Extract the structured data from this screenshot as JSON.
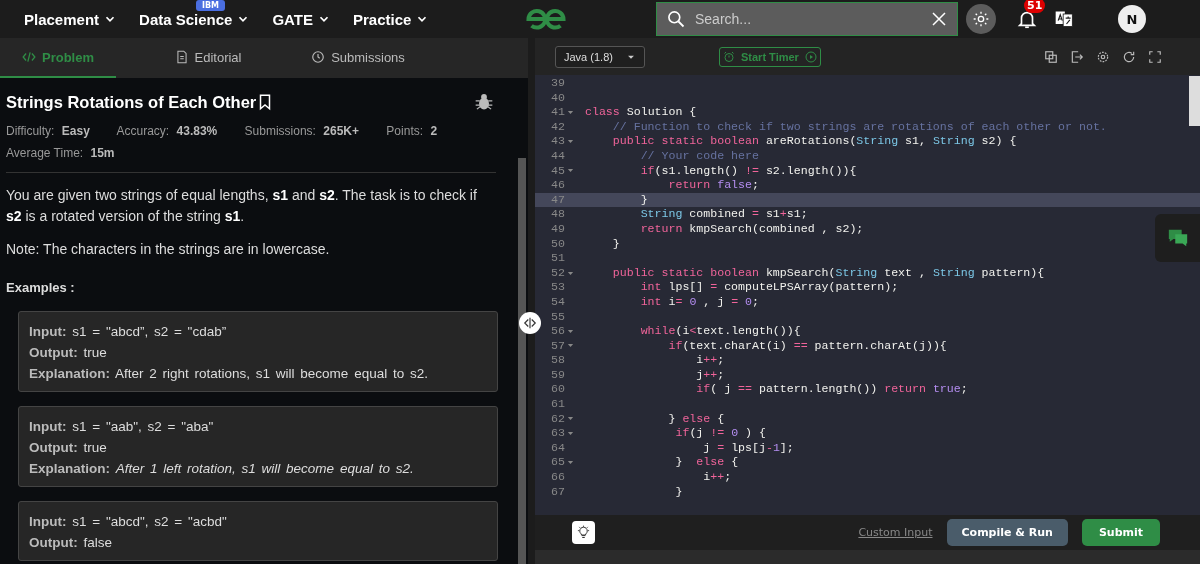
{
  "header": {
    "nav": [
      {
        "label": "Placement"
      },
      {
        "label": "Data Science",
        "badge": "IBM"
      },
      {
        "label": "GATE"
      },
      {
        "label": "Practice"
      }
    ],
    "search": {
      "placeholder": "Search..."
    },
    "notifications": "51",
    "avatar": "N"
  },
  "tabs": [
    {
      "label": "Problem",
      "selected": true
    },
    {
      "label": "Editorial",
      "selected": false
    },
    {
      "label": "Submissions",
      "selected": false
    }
  ],
  "problem": {
    "title": "Strings Rotations of Each Other",
    "meta": [
      {
        "label": "Difficulty:",
        "value": "Easy"
      },
      {
        "label": "Accuracy:",
        "value": "43.83%"
      },
      {
        "label": "Submissions:",
        "value": "265K+"
      },
      {
        "label": "Points:",
        "value": "2"
      },
      {
        "label": "Average Time:",
        "value": "15m"
      }
    ],
    "paragraphs": [
      "You are given two strings of equal lengths, **s1** and **s2**. The task is to check if **s2** is a rotated version of the string **s1**.",
      "Note: The characters in the strings are in lowercase."
    ],
    "examples_heading": "Examples :",
    "examples": [
      {
        "rows": [
          {
            "label": "Input:",
            "text": "s1 = \"abcd”, s2 = \"cdab”",
            "italic": false
          },
          {
            "label": "Output:",
            "text": "true",
            "italic": false
          },
          {
            "label": "Explanation:",
            "text": "After 2 right rotations, s1 will become equal to s2.",
            "italic": false
          }
        ]
      },
      {
        "rows": [
          {
            "label": "Input:",
            "text": "s1 = \"aab\", s2 = \"aba\"",
            "italic": false
          },
          {
            "label": "Output:",
            "text": "true",
            "italic": false
          },
          {
            "label": "Explanation:",
            "text": "After 1 left rotation, s1 will become equal to s2.",
            "italic": true
          }
        ]
      },
      {
        "rows": [
          {
            "label": "Input:",
            "text": "s1 = \"abcd\", s2 = \"acbd\"",
            "italic": false
          },
          {
            "label": "Output:",
            "text": "false",
            "italic": false
          }
        ]
      }
    ]
  },
  "editor": {
    "language": "Java (1.8)",
    "timer": "Start Timer",
    "lines": [
      {
        "number": "39",
        "foldable": false,
        "highlighted": false
      },
      {
        "number": "40",
        "foldable": false,
        "highlighted": false
      },
      {
        "number": "41",
        "foldable": true,
        "highlighted": false,
        "tokens": [
          {
            "kind": "keyword",
            "text": "class"
          },
          {
            "kind": "plain",
            "text": " Solution {"
          }
        ]
      },
      {
        "number": "42",
        "foldable": false,
        "highlighted": false,
        "tokens": [
          {
            "kind": "comment",
            "text": "    // Function to check if two strings are rotations of each other or not."
          }
        ]
      },
      {
        "number": "43",
        "foldable": true,
        "highlighted": false,
        "tokens": [
          {
            "kind": "keyword",
            "text": "    public static boolean"
          },
          {
            "kind": "plain",
            "text": " areRotations("
          },
          {
            "kind": "type",
            "text": "String"
          },
          {
            "kind": "plain",
            "text": " s1, "
          },
          {
            "kind": "type",
            "text": "String"
          },
          {
            "kind": "plain",
            "text": " s2) {"
          }
        ]
      },
      {
        "number": "44",
        "foldable": false,
        "highlighted": false,
        "tokens": [
          {
            "kind": "comment",
            "text": "        // Your code here"
          }
        ]
      },
      {
        "number": "45",
        "foldable": true,
        "highlighted": false,
        "tokens": [
          {
            "kind": "keyword",
            "text": "        if"
          },
          {
            "kind": "plain",
            "text": "(s1.length() "
          },
          {
            "kind": "operator",
            "text": "!="
          },
          {
            "kind": "plain",
            "text": " s2.length()){"
          }
        ]
      },
      {
        "number": "46",
        "foldable": false,
        "highlighted": false,
        "tokens": [
          {
            "kind": "keyword",
            "text": "            return"
          },
          {
            "kind": "constant",
            "text": " false"
          },
          {
            "kind": "plain",
            "text": ";"
          }
        ]
      },
      {
        "number": "47",
        "foldable": false,
        "highlighted": true,
        "tokens": [
          {
            "kind": "plain",
            "text": "        }"
          }
        ]
      },
      {
        "number": "48",
        "foldable": false,
        "highlighted": false,
        "tokens": [
          {
            "kind": "type",
            "text": "        String"
          },
          {
            "kind": "plain",
            "text": " combined "
          },
          {
            "kind": "operator",
            "text": "="
          },
          {
            "kind": "plain",
            "text": " s1"
          },
          {
            "kind": "operator",
            "text": "+"
          },
          {
            "kind": "plain",
            "text": "s1;"
          }
        ]
      },
      {
        "number": "49",
        "foldable": false,
        "highlighted": false,
        "tokens": [
          {
            "kind": "keyword",
            "text": "        return"
          },
          {
            "kind": "plain",
            "text": " kmpSearch(combined , s2);"
          }
        ]
      },
      {
        "number": "50",
        "foldable": false,
        "highlighted": false,
        "tokens": [
          {
            "kind": "plain",
            "text": "    }"
          }
        ]
      },
      {
        "number": "51",
        "foldable": false,
        "highlighted": false
      },
      {
        "number": "52",
        "foldable": true,
        "highlighted": false,
        "tokens": [
          {
            "kind": "keyword",
            "text": "    public static boolean"
          },
          {
            "kind": "plain",
            "text": " kmpSearch("
          },
          {
            "kind": "type",
            "text": "String"
          },
          {
            "kind": "plain",
            "text": " text , "
          },
          {
            "kind": "type",
            "text": "String"
          },
          {
            "kind": "plain",
            "text": " pattern){"
          }
        ]
      },
      {
        "number": "53",
        "foldable": false,
        "highlighted": false,
        "tokens": [
          {
            "kind": "keyword",
            "text": "        int"
          },
          {
            "kind": "plain",
            "text": " lps[] "
          },
          {
            "kind": "operator",
            "text": "="
          },
          {
            "kind": "plain",
            "text": " computeLPSArray(pattern);"
          }
        ]
      },
      {
        "number": "54",
        "foldable": false,
        "highlighted": false,
        "tokens": [
          {
            "kind": "keyword",
            "text": "        int"
          },
          {
            "kind": "plain",
            "text": " i"
          },
          {
            "kind": "operator",
            "text": "="
          },
          {
            "kind": "constant",
            "text": " 0"
          },
          {
            "kind": "plain",
            "text": " , j "
          },
          {
            "kind": "operator",
            "text": "="
          },
          {
            "kind": "constant",
            "text": " 0"
          },
          {
            "kind": "plain",
            "text": ";"
          }
        ]
      },
      {
        "number": "55",
        "foldable": false,
        "highlighted": false
      },
      {
        "number": "56",
        "foldable": true,
        "highlighted": false,
        "tokens": [
          {
            "kind": "keyword",
            "text": "        while"
          },
          {
            "kind": "plain",
            "text": "(i"
          },
          {
            "kind": "operator",
            "text": "<"
          },
          {
            "kind": "plain",
            "text": "text.length()){"
          }
        ]
      },
      {
        "number": "57",
        "foldable": true,
        "highlighted": false,
        "tokens": [
          {
            "kind": "keyword",
            "text": "            if"
          },
          {
            "kind": "plain",
            "text": "(text.charAt(i) "
          },
          {
            "kind": "operator",
            "text": "=="
          },
          {
            "kind": "plain",
            "text": " pattern.charAt(j)){"
          }
        ]
      },
      {
        "number": "58",
        "foldable": false,
        "highlighted": false,
        "tokens": [
          {
            "kind": "plain",
            "text": "                i"
          },
          {
            "kind": "operator",
            "text": "++"
          },
          {
            "kind": "plain",
            "text": ";"
          }
        ]
      },
      {
        "number": "59",
        "foldable": false,
        "highlighted": false,
        "tokens": [
          {
            "kind": "plain",
            "text": "                j"
          },
          {
            "kind": "operator",
            "text": "++"
          },
          {
            "kind": "plain",
            "text": ";"
          }
        ]
      },
      {
        "number": "60",
        "foldable": false,
        "highlighted": false,
        "tokens": [
          {
            "kind": "keyword",
            "text": "                if"
          },
          {
            "kind": "plain",
            "text": "( j "
          },
          {
            "kind": "operator",
            "text": "=="
          },
          {
            "kind": "plain",
            "text": " pattern.length()) "
          },
          {
            "kind": "keyword",
            "text": "return"
          },
          {
            "kind": "constant",
            "text": " true"
          },
          {
            "kind": "plain",
            "text": ";"
          }
        ]
      },
      {
        "number": "61",
        "foldable": false,
        "highlighted": false
      },
      {
        "number": "62",
        "foldable": true,
        "highlighted": false,
        "tokens": [
          {
            "kind": "plain",
            "text": "            } "
          },
          {
            "kind": "keyword",
            "text": "else"
          },
          {
            "kind": "plain",
            "text": " {"
          }
        ]
      },
      {
        "number": "63",
        "foldable": true,
        "highlighted": false,
        "tokens": [
          {
            "kind": "keyword",
            "text": "             if"
          },
          {
            "kind": "plain",
            "text": "(j "
          },
          {
            "kind": "operator",
            "text": "!="
          },
          {
            "kind": "constant",
            "text": " 0"
          },
          {
            "kind": "plain",
            "text": " ) {"
          }
        ]
      },
      {
        "number": "64",
        "foldable": false,
        "highlighted": false,
        "tokens": [
          {
            "kind": "plain",
            "text": "                 j "
          },
          {
            "kind": "operator",
            "text": "="
          },
          {
            "kind": "plain",
            "text": " lps[j"
          },
          {
            "kind": "operator",
            "text": "-"
          },
          {
            "kind": "constant",
            "text": "1"
          },
          {
            "kind": "plain",
            "text": "];"
          }
        ]
      },
      {
        "number": "65",
        "foldable": true,
        "highlighted": false,
        "tokens": [
          {
            "kind": "plain",
            "text": "             }  "
          },
          {
            "kind": "keyword",
            "text": "else"
          },
          {
            "kind": "plain",
            "text": " {"
          }
        ]
      },
      {
        "number": "66",
        "foldable": false,
        "highlighted": false,
        "tokens": [
          {
            "kind": "plain",
            "text": "                 i"
          },
          {
            "kind": "operator",
            "text": "++"
          },
          {
            "kind": "plain",
            "text": ";"
          }
        ]
      },
      {
        "number": "67",
        "foldable": false,
        "highlighted": false,
        "tokens": [
          {
            "kind": "plain",
            "text": "             }"
          }
        ]
      }
    ],
    "custom_input": "Custom Input",
    "compile": "Compile & Run",
    "submit": "Submit"
  }
}
